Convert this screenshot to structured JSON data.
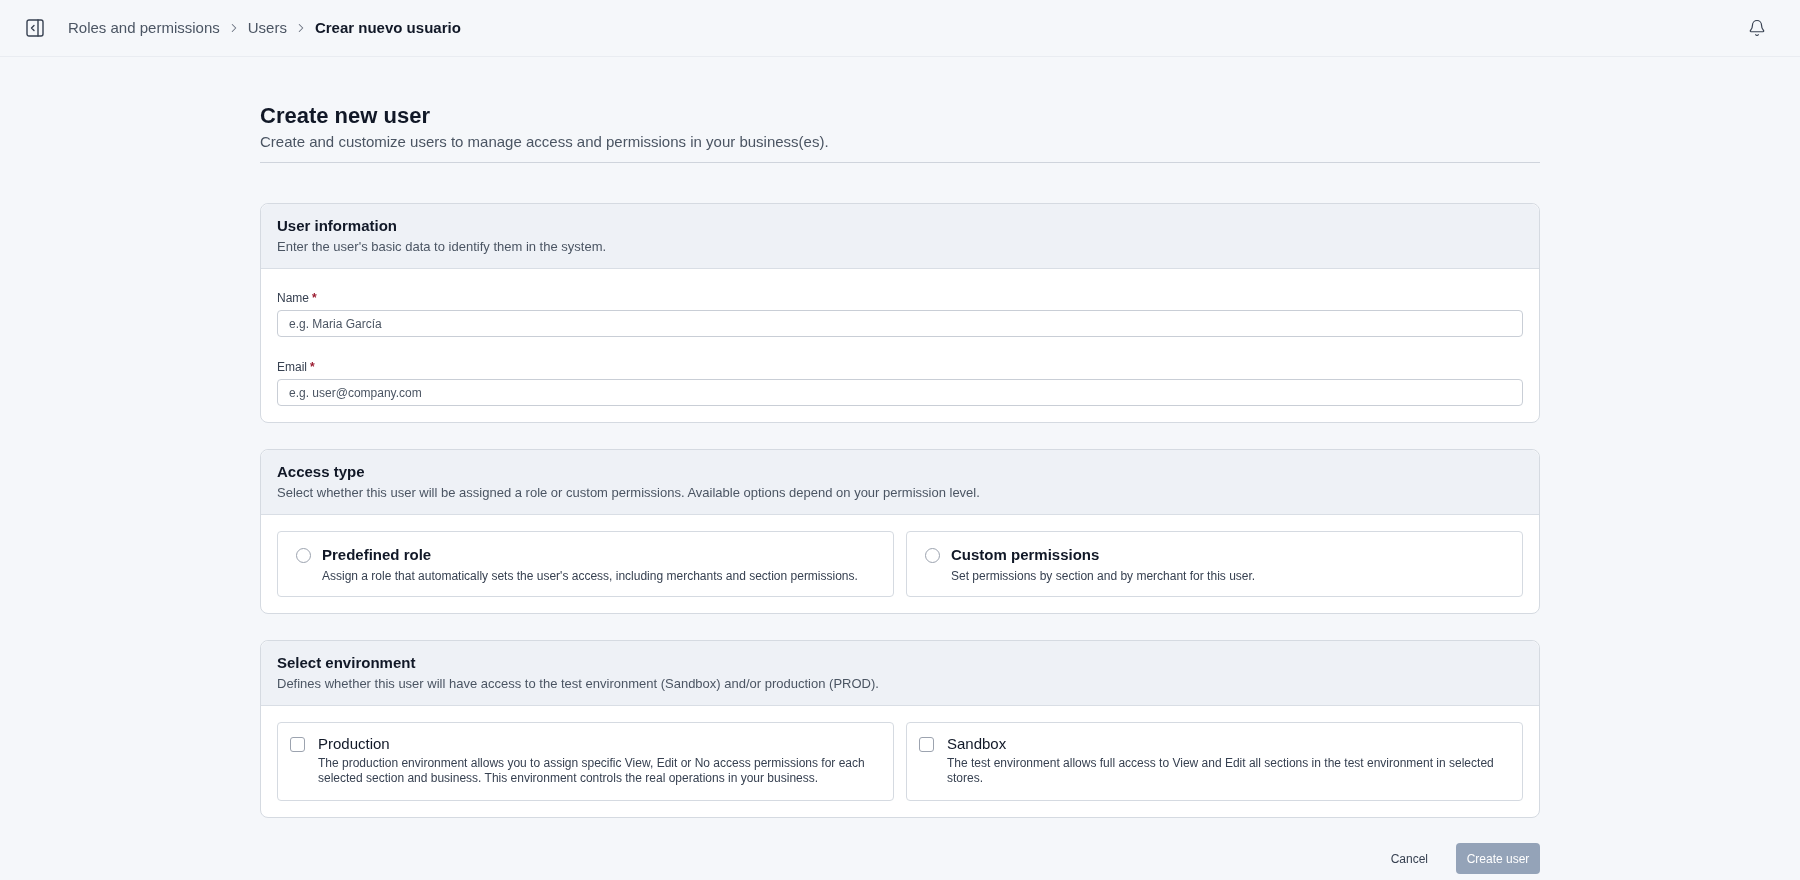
{
  "topbar": {
    "breadcrumbs": [
      {
        "label": "Roles and permissions",
        "current": false
      },
      {
        "label": "Users",
        "current": false
      },
      {
        "label": "Crear nuevo usuario",
        "current": true
      }
    ]
  },
  "page": {
    "title": "Create new user",
    "subtitle": "Create and customize users to manage access and permissions in your business(es)."
  },
  "sections": [
    {
      "kind": "fields",
      "title": "User information",
      "description": "Enter the user's basic data to identify them in the system.",
      "fields": [
        {
          "label": "Name",
          "required_mark": "*",
          "placeholder": "e.g. Maria García"
        },
        {
          "label": "Email",
          "required_mark": "*",
          "placeholder": "e.g. user@company.com"
        }
      ]
    },
    {
      "kind": "radio",
      "title": "Access type",
      "description": "Select whether this user will be assigned a role or custom permissions. Available options depend on your permission level.",
      "options": [
        {
          "title": "Predefined role",
          "description": "Assign a role that automatically sets the user's access, including merchants and section permissions.",
          "selected": false
        },
        {
          "title": "Custom permissions",
          "description": "Set permissions by section and by merchant for this user.",
          "selected": false
        }
      ]
    },
    {
      "kind": "checkbox",
      "title": "Select environment",
      "description": "Defines whether this user will have access to the test environment (Sandbox) and/or production (PROD).",
      "options": [
        {
          "title": "Production",
          "description": "The production environment allows you to assign specific View, Edit or No access permissions for each selected section and business. This environment controls the real operations in your business.",
          "checked": false
        },
        {
          "title": "Sandbox",
          "description": "The test environment allows full access to View and Edit all sections in the test environment in selected stores.",
          "checked": false
        }
      ]
    }
  ],
  "actions": [
    {
      "kind": "text",
      "label": "Cancel",
      "disabled": false
    },
    {
      "kind": "primary",
      "label": "Create user",
      "disabled": true
    }
  ]
}
